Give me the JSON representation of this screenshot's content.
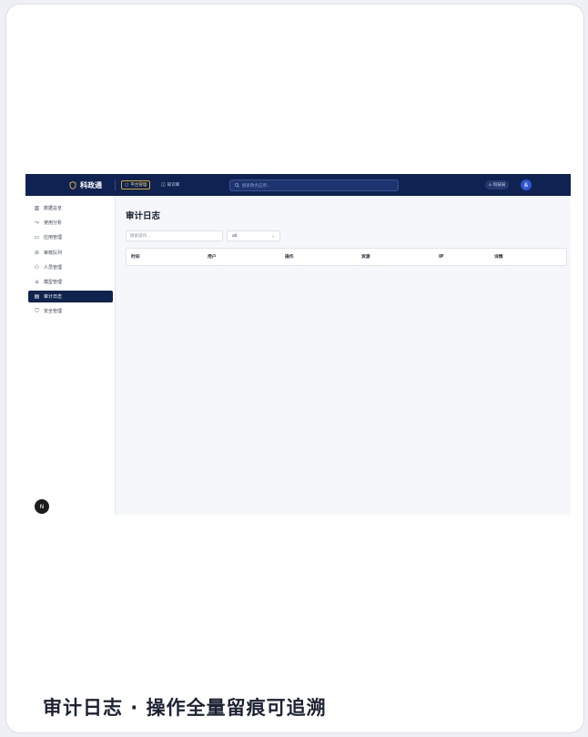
{
  "brand": {
    "name": "科政通"
  },
  "nav": {
    "tabs": [
      {
        "label": "平台管理",
        "icon": "circle-icon",
        "active": true
      },
      {
        "label": "知识库",
        "icon": "book-icon",
        "active": false
      }
    ]
  },
  "search": {
    "placeholder": "搜索政务应用..."
  },
  "tenant": {
    "label": "科技局"
  },
  "user": {
    "initial": "系"
  },
  "sidebar": {
    "items": [
      {
        "label": "数据总览",
        "icon": "bar-chart-icon",
        "glyph": "▥",
        "active": false
      },
      {
        "label": "使用分析",
        "icon": "trend-icon",
        "glyph": "⤳",
        "active": false
      },
      {
        "label": "应用管理",
        "icon": "window-icon",
        "glyph": "▭",
        "active": false
      },
      {
        "label": "审核队列",
        "icon": "check-circle-icon",
        "glyph": "⊘",
        "active": false
      },
      {
        "label": "人员管理",
        "icon": "users-icon",
        "glyph": "⚇",
        "active": false
      },
      {
        "label": "模型管理",
        "icon": "robot-icon",
        "glyph": "⌂",
        "active": false
      },
      {
        "label": "审计日志",
        "icon": "document-icon",
        "glyph": "▤",
        "active": true
      },
      {
        "label": "安全管理",
        "icon": "shield-icon",
        "glyph": "⛉",
        "active": false
      }
    ]
  },
  "badge": {
    "label": "N"
  },
  "main": {
    "title": "审计日志",
    "filter_placeholder": "搜索操作...",
    "select_value": "all",
    "columns": [
      "时间",
      "用户",
      "操作",
      "资源",
      "IP",
      "详情"
    ]
  },
  "caption": "审计日志 · 操作全量留痕可追溯",
  "colors": {
    "navbar": "#0f2251",
    "active": "#10234f",
    "accent": "#d4a72c",
    "avatar": "#2e55d4"
  }
}
